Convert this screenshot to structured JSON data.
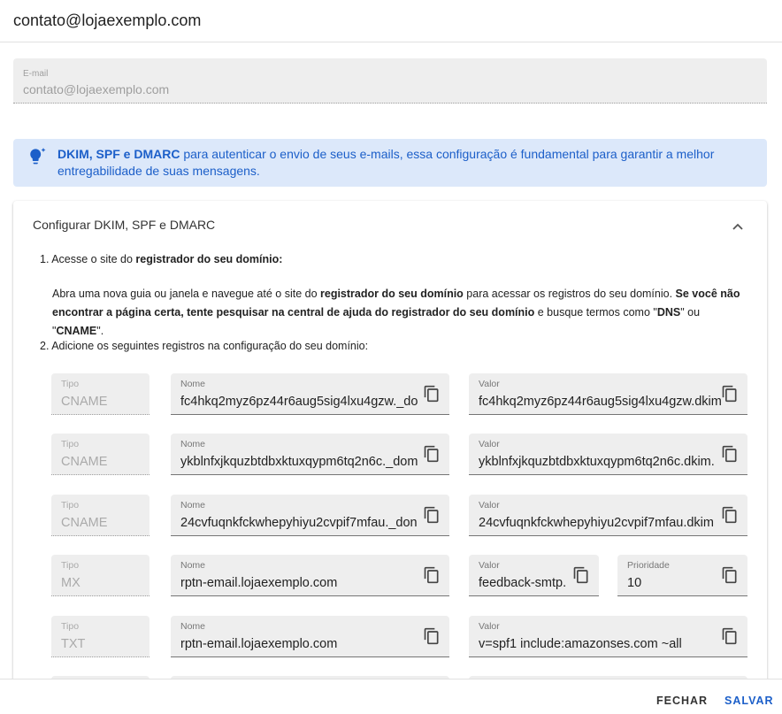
{
  "header": {
    "title": "contato@lojaexemplo.com"
  },
  "email": {
    "label": "E-mail",
    "value": "contato@lojaexemplo.com"
  },
  "alert": {
    "bold": "DKIM, SPF e DMARC",
    "text": " para autenticar o envio de seus e-mails, essa configuração é fundamental para garantir a melhor entregabilidade de suas mensagens."
  },
  "panel": {
    "title": "Configurar DKIM, SPF e DMARC",
    "step1": {
      "num": "1. ",
      "text": "Acesse o site do ",
      "bold": "registrador do seu domínio:"
    },
    "para": {
      "t1": "Abra uma nova guia ou janela e navegue até o site do ",
      "b1": "registrador do seu domínio",
      "t2": " para acessar os registros do seu domínio. ",
      "b2": "Se você não encontrar a página certa, tente pesquisar na central de ajuda do registrador do seu domínio",
      "t3": " e busque termos como \"",
      "b3": "DNS",
      "t4": "\" ou \"",
      "b4": "CNAME",
      "t5": "\"."
    },
    "step2": {
      "num": "2. ",
      "text": "Adicione os seguintes registros na configuração do seu domínio:"
    }
  },
  "records": [
    {
      "type_label": "Tipo",
      "type": "CNAME",
      "name_label": "Nome",
      "name": "fc4hkq2myz6pz44r6aug5sig4lxu4gzw._do",
      "value_label": "Valor",
      "value": "fc4hkq2myz6pz44r6aug5sig4lxu4gzw.dkim"
    },
    {
      "type_label": "Tipo",
      "type": "CNAME",
      "name_label": "Nome",
      "name": "ykblnfxjkquzbtdbxktuxqypm6tq2n6c._dom",
      "value_label": "Valor",
      "value": "ykblnfxjkquzbtdbxktuxqypm6tq2n6c.dkim."
    },
    {
      "type_label": "Tipo",
      "type": "CNAME",
      "name_label": "Nome",
      "name": "24cvfuqnkfckwhepyhiyu2cvpif7mfau._don",
      "value_label": "Valor",
      "value": "24cvfuqnkfckwhepyhiyu2cvpif7mfau.dkim"
    },
    {
      "type_label": "Tipo",
      "type": "MX",
      "name_label": "Nome",
      "name": "rptn-email.lojaexemplo.com",
      "value_label": "Valor",
      "value": "feedback-smtp.",
      "priority_label": "Prioridade",
      "priority": "10"
    },
    {
      "type_label": "Tipo",
      "type": "TXT",
      "name_label": "Nome",
      "name": "rptn-email.lojaexemplo.com",
      "value_label": "Valor",
      "value": "v=spf1 include:amazonses.com ~all"
    }
  ],
  "footer": {
    "close": "FECHAR",
    "save": "SALVAR"
  },
  "colors": {
    "accent": "#1c5fc9",
    "alert_bg": "#dce8fa",
    "field_bg": "#eeeeee"
  },
  "icons": {
    "alert": "lightbulb-icon",
    "collapse": "chevron-up-icon",
    "copy": "copy-icon"
  }
}
